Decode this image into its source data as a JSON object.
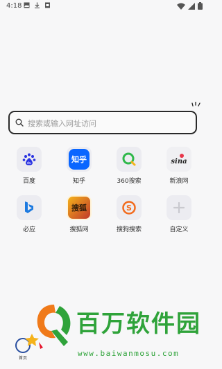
{
  "status_bar": {
    "time": "4:18",
    "left_icons": [
      "image-icon",
      "download-icon",
      "document-icon"
    ],
    "right_icons": [
      "wifi-icon",
      "cellular-icon",
      "battery-icon"
    ]
  },
  "search": {
    "placeholder": "搜索或输入网址访问"
  },
  "quick_links": [
    {
      "label": "百度",
      "icon": "baidu-icon",
      "color": "#2932e1"
    },
    {
      "label": "知乎",
      "icon": "zhihu-icon",
      "color": "#0a66ff",
      "glyph": "知乎"
    },
    {
      "label": "360搜索",
      "icon": "360-search-icon",
      "color": "#2fb84a"
    },
    {
      "label": "新浪网",
      "icon": "sina-icon",
      "color": "#e6162d",
      "glyph": "sina"
    },
    {
      "label": "必应",
      "icon": "bing-icon",
      "color": "#1d7ae0"
    },
    {
      "label": "搜狐网",
      "icon": "sohu-icon",
      "color": "#f5b21a",
      "glyph": "搜狐"
    },
    {
      "label": "搜狗搜索",
      "icon": "sogou-icon",
      "color": "#f26b1d"
    },
    {
      "label": "自定义",
      "icon": "add-icon",
      "color": "#c9c9cf"
    }
  ],
  "bottom_nav": {
    "home_label": "首页"
  },
  "watermark": {
    "text": "百万软件园",
    "url": "www.baiwanmosu.com"
  }
}
